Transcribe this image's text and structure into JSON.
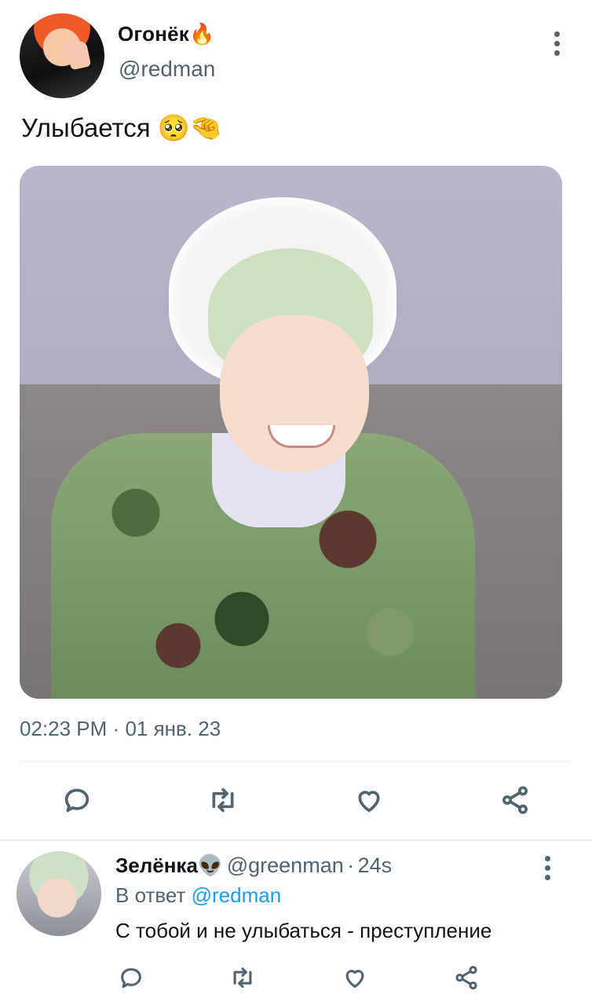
{
  "tweet": {
    "author_name": "Огонёк",
    "author_emoji": "🔥",
    "author_handle": "@redman",
    "text": "Улыбается",
    "text_emoji": "🥺🤏",
    "timestamp_time": "02:23 PM",
    "timestamp_sep": "·",
    "timestamp_date": "01 янв. 23",
    "actions": [
      "reply-icon",
      "retweet-icon",
      "like-icon",
      "share-icon"
    ]
  },
  "reply": {
    "author_name": "Зелёнка",
    "author_emoji": "👽",
    "author_handle": "@greenman",
    "time_sep": "·",
    "time": "24s",
    "reply_prefix": "В ответ",
    "reply_to": "@redman",
    "text": "С тобой и не улыбаться - преступление",
    "actions": [
      "reply-icon",
      "retweet-icon",
      "like-icon",
      "share-icon"
    ]
  },
  "colors": {
    "text": "#0f1419",
    "secondary": "#536471",
    "link": "#1d9bf0",
    "divider": "#e6ecf0"
  }
}
